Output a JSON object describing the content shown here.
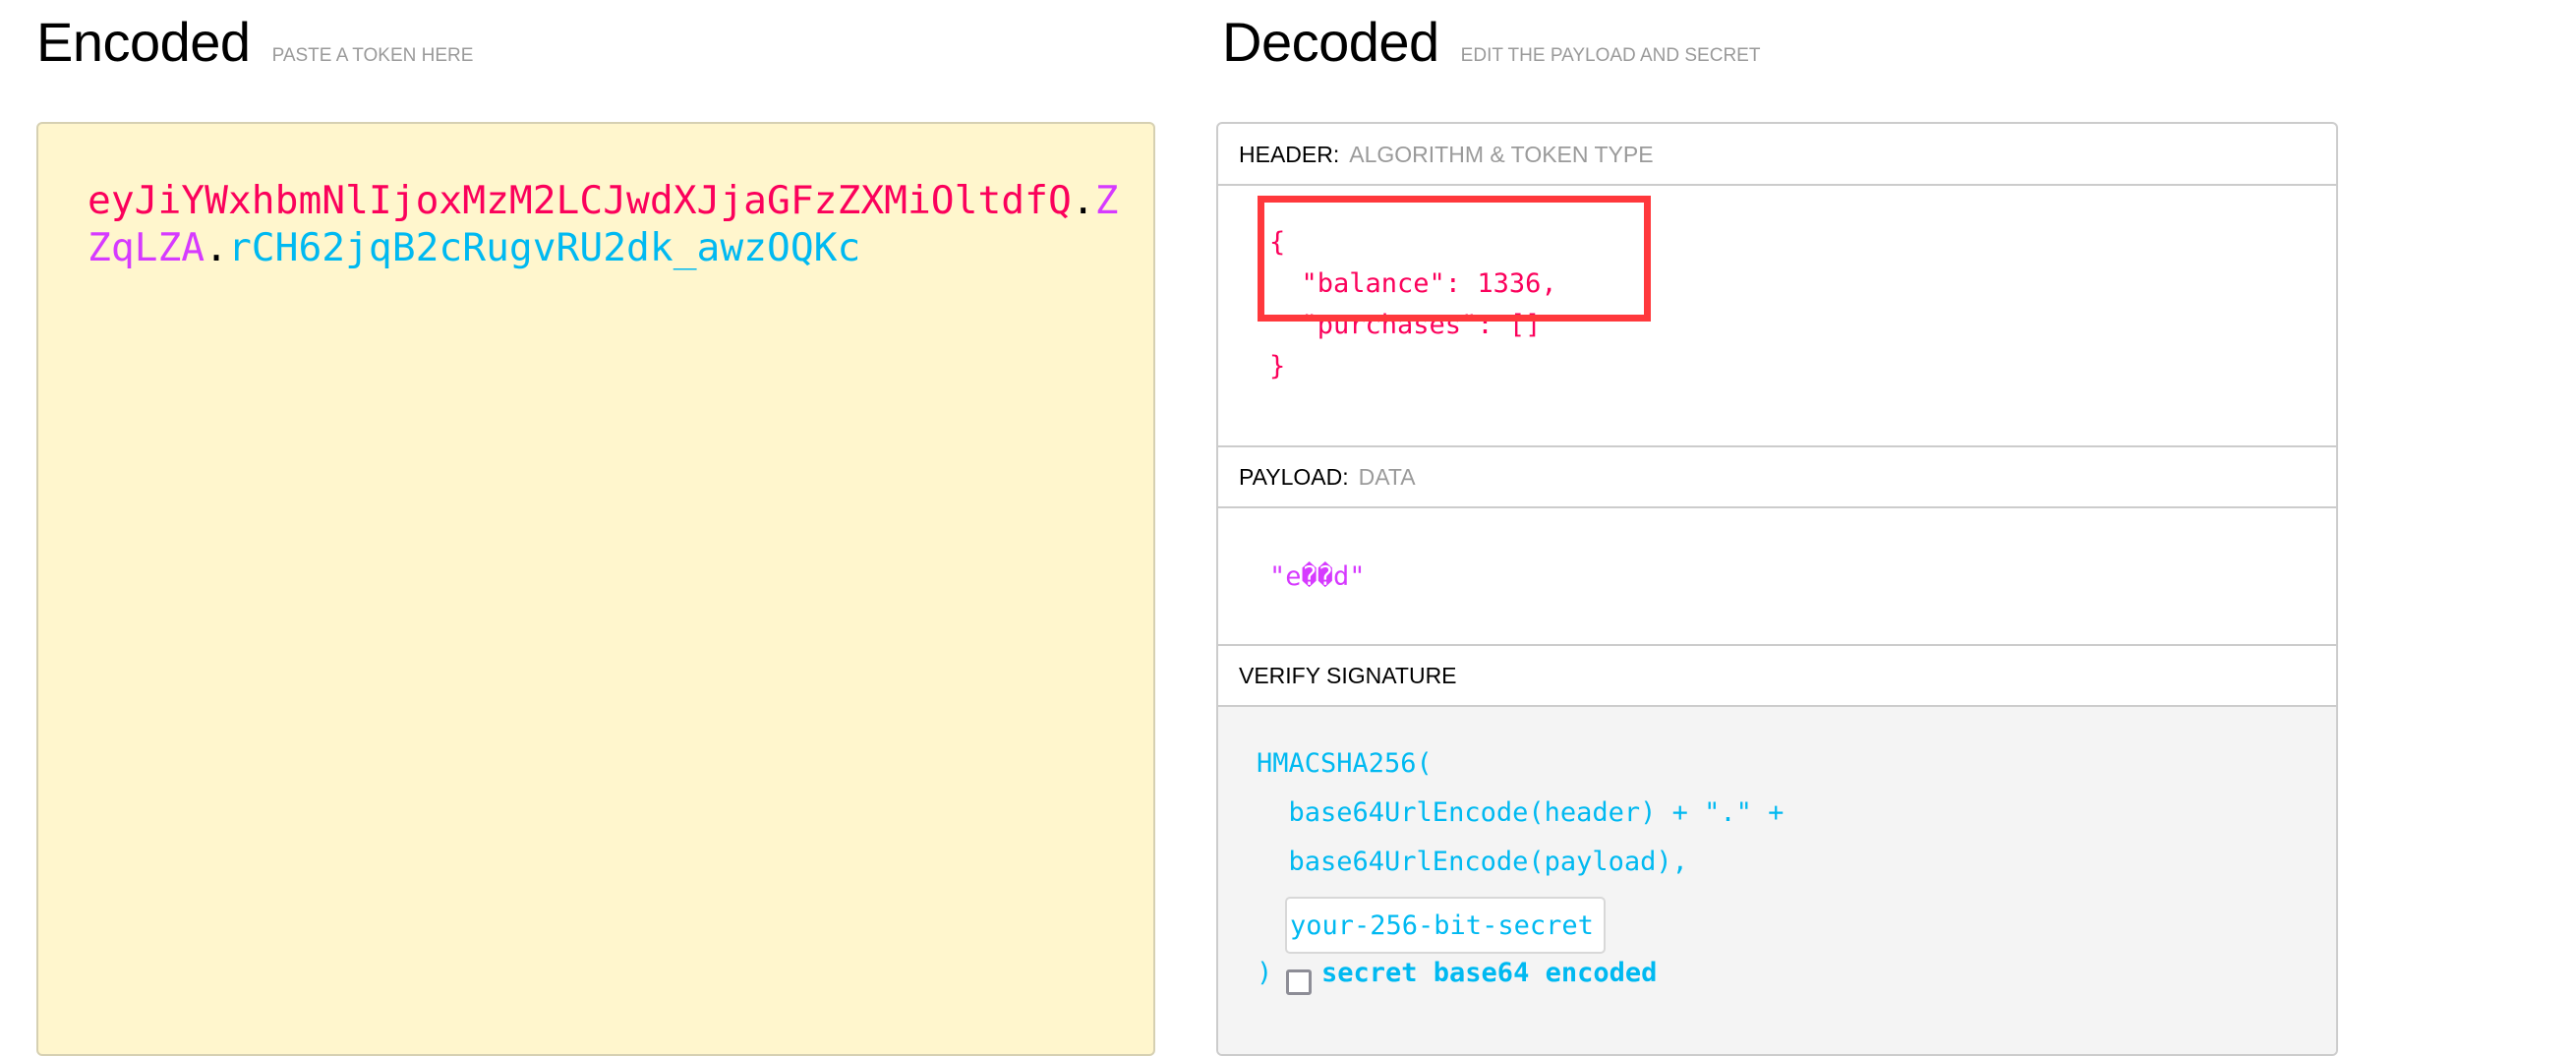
{
  "encoded": {
    "title": "Encoded",
    "subtitle": "PASTE A TOKEN HERE",
    "token": {
      "header_part": "eyJiYWxhbmNlIjoxMzM2LCJwdXJjaGFzZXMiOltdfQ",
      "dot1": ".",
      "payload_part": "ZZqLZA",
      "dot2": ".",
      "signature_part": "rCH62jqB2cRugvRU2dk_awzOQKc"
    }
  },
  "decoded": {
    "title": "Decoded",
    "subtitle": "EDIT THE PAYLOAD AND SECRET",
    "header_section": {
      "label": "HEADER:",
      "description": "ALGORITHM & TOKEN TYPE",
      "json_lines": [
        "{",
        "  \"balance\": 1336,",
        "  \"purchases\": []",
        "}"
      ]
    },
    "payload_section": {
      "label": "PAYLOAD:",
      "description": "DATA",
      "value": "\"e��d\""
    },
    "signature_section": {
      "label": "VERIFY SIGNATURE",
      "lines": {
        "open": "HMACSHA256(",
        "header_line": "  base64UrlEncode(header) + \".\" +",
        "payload_line": "  base64UrlEncode(payload),",
        "close": ")"
      },
      "secret_input": {
        "value": "your-256-bit-secret"
      },
      "base64_checkbox": {
        "label": "secret base64 encoded",
        "checked": false
      }
    }
  },
  "colors": {
    "token_header": "#fb015b",
    "token_payload": "#d63aff",
    "token_signature": "#00b9f1",
    "encoded_background": "#fff6cd",
    "highlight_box": "#ff383c"
  }
}
